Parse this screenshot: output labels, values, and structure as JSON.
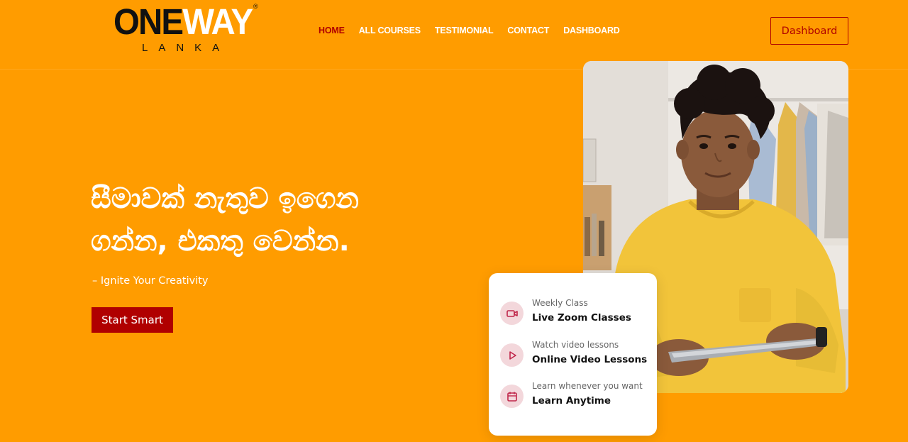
{
  "header": {
    "logo": {
      "brand_dark": "ONE",
      "brand_light": "WAY",
      "registered": "®",
      "sub": "LANKA"
    },
    "nav": [
      {
        "label": "HOME",
        "active": true
      },
      {
        "label": "ALL COURSES",
        "active": false
      },
      {
        "label": "TESTIMONIAL",
        "active": false
      },
      {
        "label": "CONTACT",
        "active": false
      },
      {
        "label": "DASHBOARD",
        "active": false
      }
    ],
    "dashboard_button": "Dashboard"
  },
  "hero": {
    "title_line1": "සීමාවක් නැතුව ඉගෙන",
    "title_line2": "ගන්න, එකතු වෙන්න.",
    "tagline": "– Ignite Your Creativity",
    "cta": "Start Smart"
  },
  "features": [
    {
      "icon": "video-camera-icon",
      "sub": "Weekly Class",
      "main": "Live Zoom Classes"
    },
    {
      "icon": "play-icon",
      "sub": "Watch video lessons",
      "main": "Online Video Lessons"
    },
    {
      "icon": "calendar-icon",
      "sub": "Learn whenever you want",
      "main": "Learn Anytime"
    }
  ],
  "colors": {
    "background": "#FF9C00",
    "accent": "#B00000",
    "icon_bg": "#F3D7DB",
    "icon_stroke": "#C0264A"
  }
}
